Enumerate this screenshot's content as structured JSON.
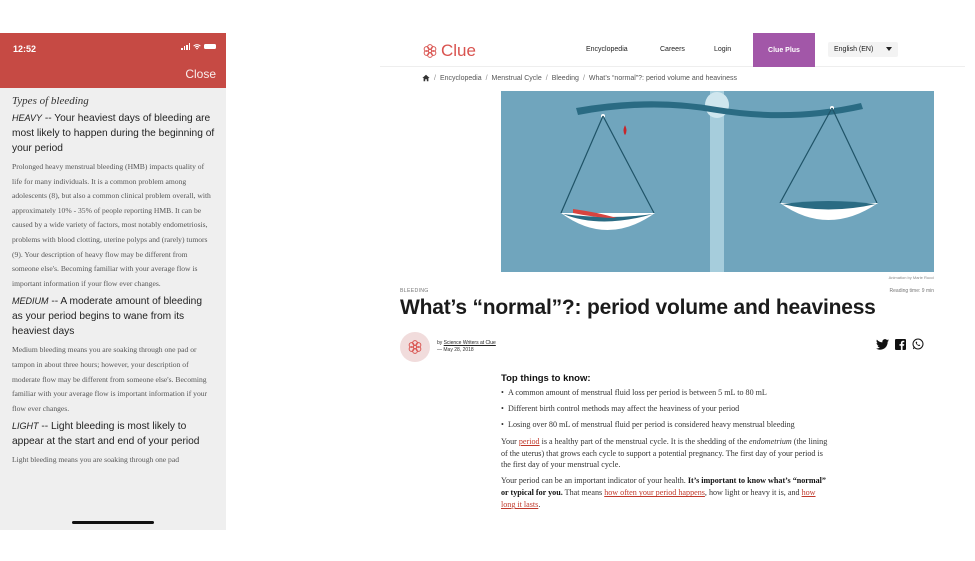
{
  "phone": {
    "status_time": "12:52",
    "close_label": "Close",
    "title": "Types of bleeding",
    "sections": [
      {
        "level": "HEAVY",
        "heading": "Your heaviest days of bleeding are most likely to happen during the beginning of your period",
        "body": "Prolonged heavy menstrual bleeding (HMB) impacts quality of life for many individuals. It is a common problem among adolescents (8), but also a common clinical problem overall, with approximately 10% - 35% of people reporting HMB. It can be caused by a wide variety of factors, most notably endometriosis, problems with blood clotting, uterine polyps and (rarely) tumors (9). Your description of heavy flow may be different from someone else's. Becoming familiar with your average flow is important information if your flow ever changes."
      },
      {
        "level": "MEDIUM",
        "heading": "A moderate amount of bleeding as your period begins to wane from its heaviest days",
        "body": "Medium bleeding means you are soaking through one pad or tampon in about three hours; however, your description of moderate flow may be different from someone else's. Becoming familiar with your average flow is important information if your flow ever changes."
      },
      {
        "level": "LIGHT",
        "heading": "Light bleeding is most likely to appear at the start and end of your period",
        "body": "Light bleeding means you are soaking through one pad"
      }
    ]
  },
  "site": {
    "logo_text": "Clue",
    "nav": {
      "encyclopedia": "Encyclopedia",
      "careers": "Careers",
      "login": "Login",
      "clue_plus": "Clue Plus",
      "language": "English (EN)"
    },
    "breadcrumb": {
      "items": [
        "Encyclopedia",
        "Menstrual Cycle",
        "Bleeding",
        "What’s “normal”?: period volume and heaviness"
      ]
    },
    "hero_caption": "Animation by Marie Rucci",
    "category": "BLEEDING",
    "reading_time": "Reading time: 9 min",
    "title": "What’s “normal”?: period volume and heaviness",
    "author": {
      "by": "by",
      "name": "Science Writers at Clue",
      "date": "— May 28, 2018"
    },
    "article": {
      "top_heading": "Top things to know:",
      "bullets": [
        "A common amount of menstrual fluid loss per period is between 5 mL to 80 mL",
        "Different birth control methods may affect the heaviness of your period",
        "Losing over 80 mL of menstrual fluid per period is considered heavy menstrual bleeding"
      ],
      "p1_a": "Your ",
      "p1_link": "period",
      "p1_b": " is a healthy part of the menstrual cycle. It is the shedding of the ",
      "p1_em": "endometrium",
      "p1_c": " (the lining of the uterus) that grows each cycle to support a potential pregnancy. The first day of your period is the first day of your menstrual cycle.",
      "p2_a": "Your period can be an important indicator of your health. ",
      "p2_bold": "It’s important to know what’s “normal” or typical for you.",
      "p2_b": " That means ",
      "p2_link1": "how often your period happens",
      "p2_c": ", how light or heavy it is, and ",
      "p2_link2": "how long it lasts",
      "p2_d": "."
    }
  },
  "colors": {
    "phone_header": "#c64a44",
    "clue_plus": "#a257a8",
    "brand_red": "#d9534f",
    "hero_bg": "#70a5bd",
    "link": "#c0392b"
  }
}
